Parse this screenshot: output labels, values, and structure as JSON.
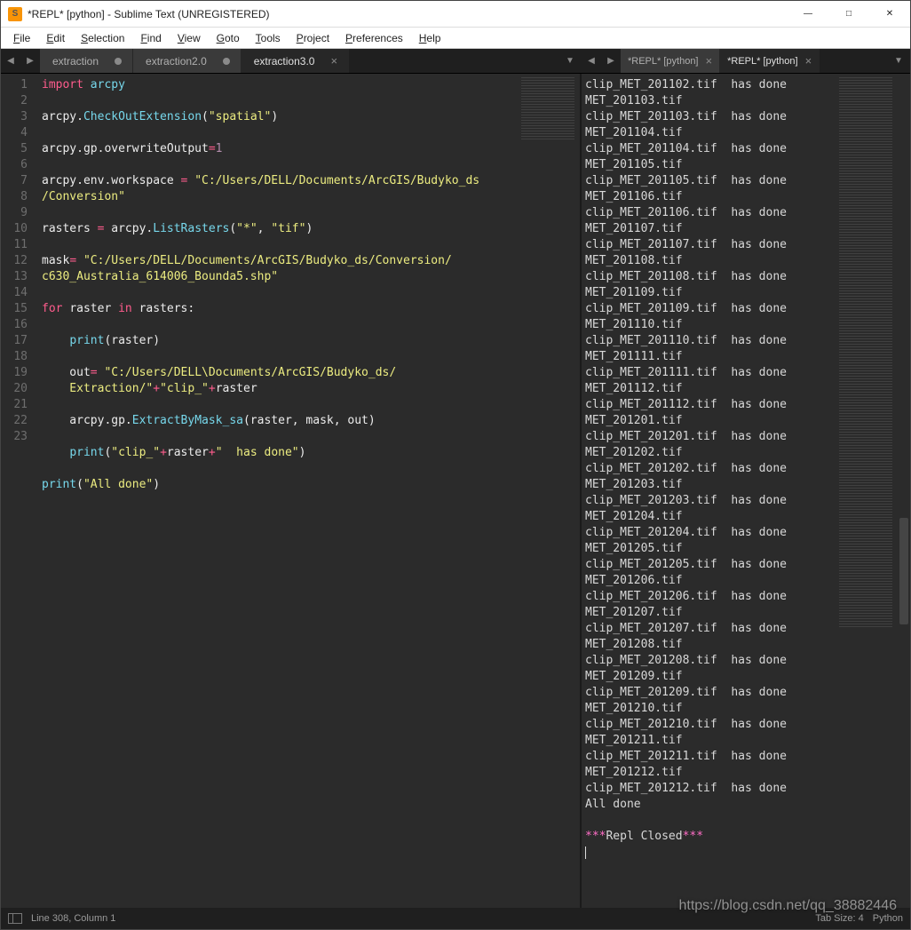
{
  "window": {
    "title": "*REPL* [python] - Sublime Text (UNREGISTERED)"
  },
  "menubar": [
    "File",
    "Edit",
    "Selection",
    "Find",
    "View",
    "Goto",
    "Tools",
    "Project",
    "Preferences",
    "Help"
  ],
  "left_tabs": [
    {
      "label": "extraction",
      "dirty": true,
      "active": false
    },
    {
      "label": "extraction2.0",
      "dirty": true,
      "active": false
    },
    {
      "label": "extraction3.0",
      "dirty": false,
      "active": true
    }
  ],
  "right_tabs": [
    {
      "label": "*REPL* [python]",
      "dirty": false,
      "active": false
    },
    {
      "label": "*REPL* [python]",
      "dirty": false,
      "active": true
    }
  ],
  "code": {
    "lines": [
      {
        "n": 1,
        "tokens": [
          {
            "t": "import ",
            "c": "kw"
          },
          {
            "t": "arcpy",
            "c": "ky"
          }
        ]
      },
      {
        "n": 2,
        "tokens": []
      },
      {
        "n": 3,
        "tokens": [
          {
            "t": "arcpy",
            "c": "var"
          },
          {
            "t": ".",
            "c": ""
          },
          {
            "t": "CheckOutExtension",
            "c": "fn"
          },
          {
            "t": "(",
            "c": ""
          },
          {
            "t": "\"spatial\"",
            "c": "str"
          },
          {
            "t": ")",
            "c": ""
          }
        ]
      },
      {
        "n": 4,
        "tokens": []
      },
      {
        "n": 5,
        "tokens": [
          {
            "t": "arcpy.gp.overwriteOutput",
            "c": "var"
          },
          {
            "t": "=",
            "c": "kw"
          },
          {
            "t": "1",
            "c": "num"
          }
        ]
      },
      {
        "n": 6,
        "tokens": []
      },
      {
        "n": 7,
        "tokens": [
          {
            "t": "arcpy.env.workspace ",
            "c": "var"
          },
          {
            "t": "= ",
            "c": "kw"
          },
          {
            "t": "\"C:/Users/DELL/Documents/ArcGIS/Budyko_ds",
            "c": "str"
          }
        ]
      },
      {
        "n": null,
        "tokens": [
          {
            "t": "/Conversion\"",
            "c": "str"
          }
        ]
      },
      {
        "n": 8,
        "tokens": []
      },
      {
        "n": 9,
        "tokens": [
          {
            "t": "rasters ",
            "c": "var"
          },
          {
            "t": "= ",
            "c": "kw"
          },
          {
            "t": "arcpy.",
            "c": "var"
          },
          {
            "t": "ListRasters",
            "c": "fn"
          },
          {
            "t": "(",
            "c": ""
          },
          {
            "t": "\"*\"",
            "c": "str"
          },
          {
            "t": ", ",
            "c": ""
          },
          {
            "t": "\"tif\"",
            "c": "str"
          },
          {
            "t": ")",
            "c": ""
          }
        ]
      },
      {
        "n": 10,
        "tokens": []
      },
      {
        "n": 11,
        "tokens": [
          {
            "t": "mask",
            "c": "var"
          },
          {
            "t": "= ",
            "c": "kw"
          },
          {
            "t": "\"C:/Users/DELL/Documents/ArcGIS/Budyko_ds/Conversion/",
            "c": "str"
          }
        ]
      },
      {
        "n": null,
        "tokens": [
          {
            "t": "c630_Australia_614006_Bounda5.shp\"",
            "c": "str"
          }
        ]
      },
      {
        "n": 12,
        "tokens": []
      },
      {
        "n": 13,
        "tokens": [
          {
            "t": "for ",
            "c": "kw"
          },
          {
            "t": "raster ",
            "c": "var"
          },
          {
            "t": "in ",
            "c": "kw"
          },
          {
            "t": "rasters:",
            "c": "var"
          }
        ]
      },
      {
        "n": 14,
        "tokens": []
      },
      {
        "n": 15,
        "tokens": [
          {
            "t": "    ",
            "c": ""
          },
          {
            "t": "print",
            "c": "fn"
          },
          {
            "t": "(raster)",
            "c": ""
          }
        ]
      },
      {
        "n": 16,
        "tokens": []
      },
      {
        "n": 17,
        "tokens": [
          {
            "t": "    out",
            "c": "var"
          },
          {
            "t": "= ",
            "c": "kw"
          },
          {
            "t": "\"C:/Users/DELL\\Documents/ArcGIS/Budyko_ds/",
            "c": "str"
          }
        ]
      },
      {
        "n": null,
        "tokens": [
          {
            "t": "    Extraction/\"",
            "c": "str"
          },
          {
            "t": "+",
            "c": "kw"
          },
          {
            "t": "\"clip_\"",
            "c": "str"
          },
          {
            "t": "+",
            "c": "kw"
          },
          {
            "t": "raster",
            "c": "var"
          }
        ]
      },
      {
        "n": 18,
        "tokens": []
      },
      {
        "n": 19,
        "tokens": [
          {
            "t": "    arcpy.gp.",
            "c": "var"
          },
          {
            "t": "ExtractByMask_sa",
            "c": "fn"
          },
          {
            "t": "(raster, mask, out)",
            "c": ""
          }
        ]
      },
      {
        "n": 20,
        "tokens": []
      },
      {
        "n": 21,
        "tokens": [
          {
            "t": "    ",
            "c": ""
          },
          {
            "t": "print",
            "c": "fn"
          },
          {
            "t": "(",
            "c": ""
          },
          {
            "t": "\"clip_\"",
            "c": "str"
          },
          {
            "t": "+",
            "c": "kw"
          },
          {
            "t": "raster",
            "c": "var"
          },
          {
            "t": "+",
            "c": "kw"
          },
          {
            "t": "\"  has done\"",
            "c": "str"
          },
          {
            "t": ")",
            "c": ""
          }
        ]
      },
      {
        "n": 22,
        "tokens": []
      },
      {
        "n": 23,
        "tokens": [
          {
            "t": "print",
            "c": "fn"
          },
          {
            "t": "(",
            "c": ""
          },
          {
            "t": "\"All done\"",
            "c": "str"
          },
          {
            "t": ")",
            "c": ""
          }
        ]
      }
    ]
  },
  "repl_output": [
    "clip_MET_201102.tif  has done",
    "MET_201103.tif",
    "clip_MET_201103.tif  has done",
    "MET_201104.tif",
    "clip_MET_201104.tif  has done",
    "MET_201105.tif",
    "clip_MET_201105.tif  has done",
    "MET_201106.tif",
    "clip_MET_201106.tif  has done",
    "MET_201107.tif",
    "clip_MET_201107.tif  has done",
    "MET_201108.tif",
    "clip_MET_201108.tif  has done",
    "MET_201109.tif",
    "clip_MET_201109.tif  has done",
    "MET_201110.tif",
    "clip_MET_201110.tif  has done",
    "MET_201111.tif",
    "clip_MET_201111.tif  has done",
    "MET_201112.tif",
    "clip_MET_201112.tif  has done",
    "MET_201201.tif",
    "clip_MET_201201.tif  has done",
    "MET_201202.tif",
    "clip_MET_201202.tif  has done",
    "MET_201203.tif",
    "clip_MET_201203.tif  has done",
    "MET_201204.tif",
    "clip_MET_201204.tif  has done",
    "MET_201205.tif",
    "clip_MET_201205.tif  has done",
    "MET_201206.tif",
    "clip_MET_201206.tif  has done",
    "MET_201207.tif",
    "clip_MET_201207.tif  has done",
    "MET_201208.tif",
    "clip_MET_201208.tif  has done",
    "MET_201209.tif",
    "clip_MET_201209.tif  has done",
    "MET_201210.tif",
    "clip_MET_201210.tif  has done",
    "MET_201211.tif",
    "clip_MET_201211.tif  has done",
    "MET_201212.tif",
    "clip_MET_201212.tif  has done",
    "All done",
    ""
  ],
  "repl_closed_prefix": "***",
  "repl_closed_mid": "Repl Closed",
  "repl_closed_suffix": "***",
  "status": {
    "position": "Line 308, Column 1",
    "spaces": "Tab Size: 4",
    "syntax": "Python"
  },
  "watermark": "https://blog.csdn.net/qq_38882446"
}
